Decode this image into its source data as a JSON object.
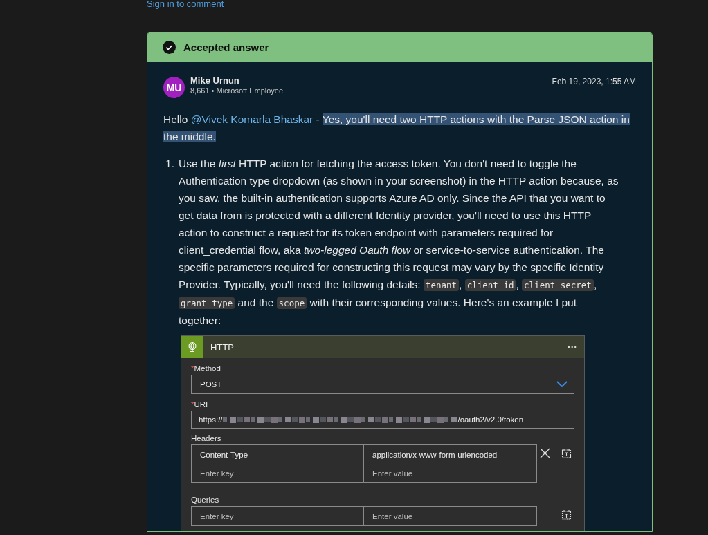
{
  "sign_in_link": "Sign in to comment",
  "answer": {
    "badge": "Accepted answer",
    "accepted": true,
    "author": {
      "initials": "MU",
      "name": "Mike Urnun",
      "meta": "8,661 • Microsoft Employee",
      "date": "Feb 19, 2023, 1:55 AM"
    },
    "greeting": {
      "hello": "Hello",
      "mention": "@Vivek Komarla Bhaskar",
      "dash": "-",
      "highlighted": "Yes, you'll need two HTTP actions with the Parse JSON action in the middle."
    },
    "steps": [
      {
        "number": "1.",
        "segments": [
          {
            "kind": "text",
            "text": "Use the "
          },
          {
            "kind": "em",
            "text": "first"
          },
          {
            "kind": "text",
            "text": " HTTP action for fetching the access token. You don't need to toggle the Authentication type dropdown (as shown in your screenshot) in the HTTP action because, as you saw, the built-in authentication supports Azure AD only. Since the API that you want to get data from is protected with a different Identity provider, you'll need to use this HTTP action to construct a request for its token endpoint with parameters required for client_credential flow, aka "
          },
          {
            "kind": "em",
            "text": "two-legged Oauth flow"
          },
          {
            "kind": "text",
            "text": " or service-to-service authentication. The specific parameters required for constructing this request may vary by the specific Identity Provider. Typically, you'll need the following details: "
          },
          {
            "kind": "code",
            "text": "tenant"
          },
          {
            "kind": "text",
            "text": ", "
          },
          {
            "kind": "code",
            "text": "client_id"
          },
          {
            "kind": "text",
            "text": ", "
          },
          {
            "kind": "code",
            "text": "client_secret"
          },
          {
            "kind": "text",
            "text": ", "
          },
          {
            "kind": "code",
            "text": "grant_type"
          },
          {
            "kind": "text",
            "text": " and the "
          },
          {
            "kind": "code",
            "text": "scope"
          },
          {
            "kind": "text",
            "text": " with their corresponding values. Here's an example I put together:"
          }
        ]
      }
    ],
    "http_action": {
      "title": "HTTP",
      "more": "···",
      "required_mark": "*",
      "method_label": "Method",
      "method_required": true,
      "method_value": "POST",
      "uri_label": "URI",
      "uri_required": true,
      "uri_prefix": "https://",
      "uri_suffix": "/oauth2/v2.0/token",
      "headers_label": "Headers",
      "headers_removable": true,
      "headers": [
        {
          "key": "Content-Type",
          "value": "application/x-www-form-urlencoded",
          "placeholder": false
        },
        {
          "key": "Enter key",
          "value": "Enter value",
          "placeholder": true
        }
      ],
      "queries_label": "Queries",
      "queries": [
        {
          "key": "Enter key",
          "value": "Enter value",
          "placeholder": true
        }
      ]
    }
  }
}
